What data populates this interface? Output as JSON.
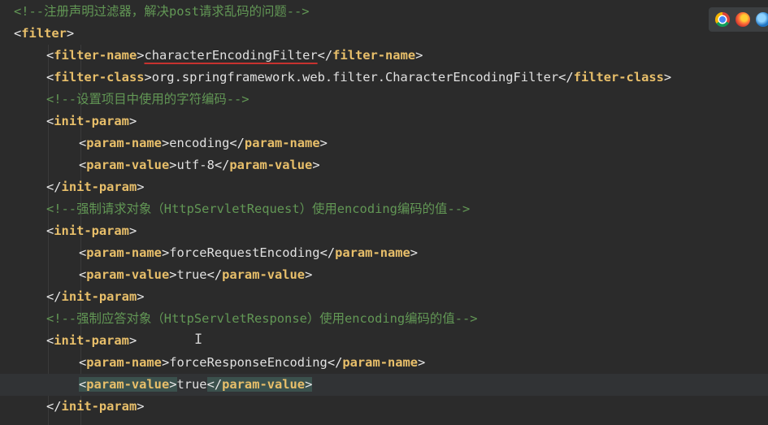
{
  "editor": {
    "lines": [
      {
        "indent": 0,
        "tokens": [
          {
            "t": "c",
            "v": "<!--注册声明过滤器，解决post请求乱码的问题-->"
          }
        ]
      },
      {
        "indent": 0,
        "tokens": [
          {
            "t": "b",
            "v": "<"
          },
          {
            "t": "g",
            "v": "filter"
          },
          {
            "t": "b",
            "v": ">"
          }
        ]
      },
      {
        "indent": 1,
        "tokens": [
          {
            "t": "b",
            "v": "<"
          },
          {
            "t": "g",
            "v": "filter-name"
          },
          {
            "t": "b",
            "v": ">"
          },
          {
            "t": "x",
            "v": "characterEncodingFilter",
            "squiggle": true
          },
          {
            "t": "b",
            "v": "</"
          },
          {
            "t": "g",
            "v": "filter-name"
          },
          {
            "t": "b",
            "v": ">"
          }
        ]
      },
      {
        "indent": 1,
        "tokens": [
          {
            "t": "b",
            "v": "<"
          },
          {
            "t": "g",
            "v": "filter-class"
          },
          {
            "t": "b",
            "v": ">"
          },
          {
            "t": "x",
            "v": "org.springframework.web.filter.CharacterEncodingFilter"
          },
          {
            "t": "b",
            "v": "</"
          },
          {
            "t": "g",
            "v": "filter-class"
          },
          {
            "t": "b",
            "v": ">"
          }
        ]
      },
      {
        "indent": 1,
        "tokens": [
          {
            "t": "c",
            "v": "<!--设置项目中使用的字符编码-->"
          }
        ]
      },
      {
        "indent": 1,
        "tokens": [
          {
            "t": "b",
            "v": "<"
          },
          {
            "t": "g",
            "v": "init-param"
          },
          {
            "t": "b",
            "v": ">"
          }
        ]
      },
      {
        "indent": 2,
        "tokens": [
          {
            "t": "b",
            "v": "<"
          },
          {
            "t": "g",
            "v": "param-name"
          },
          {
            "t": "b",
            "v": ">"
          },
          {
            "t": "x",
            "v": "encoding"
          },
          {
            "t": "b",
            "v": "</"
          },
          {
            "t": "g",
            "v": "param-name"
          },
          {
            "t": "b",
            "v": ">"
          }
        ]
      },
      {
        "indent": 2,
        "tokens": [
          {
            "t": "b",
            "v": "<"
          },
          {
            "t": "g",
            "v": "param-value"
          },
          {
            "t": "b",
            "v": ">"
          },
          {
            "t": "x",
            "v": "utf-8"
          },
          {
            "t": "b",
            "v": "</"
          },
          {
            "t": "g",
            "v": "param-value"
          },
          {
            "t": "b",
            "v": ">"
          }
        ]
      },
      {
        "indent": 1,
        "tokens": [
          {
            "t": "b",
            "v": "</"
          },
          {
            "t": "g",
            "v": "init-param"
          },
          {
            "t": "b",
            "v": ">"
          }
        ]
      },
      {
        "indent": 1,
        "tokens": [
          {
            "t": "c",
            "v": "<!--强制请求对象（HttpServletRequest）使用encoding编码的值-->"
          }
        ]
      },
      {
        "indent": 1,
        "tokens": [
          {
            "t": "b",
            "v": "<"
          },
          {
            "t": "g",
            "v": "init-param"
          },
          {
            "t": "b",
            "v": ">"
          }
        ]
      },
      {
        "indent": 2,
        "tokens": [
          {
            "t": "b",
            "v": "<"
          },
          {
            "t": "g",
            "v": "param-name"
          },
          {
            "t": "b",
            "v": ">"
          },
          {
            "t": "x",
            "v": "forceRequestEncoding"
          },
          {
            "t": "b",
            "v": "</"
          },
          {
            "t": "g",
            "v": "param-name"
          },
          {
            "t": "b",
            "v": ">"
          }
        ]
      },
      {
        "indent": 2,
        "tokens": [
          {
            "t": "b",
            "v": "<"
          },
          {
            "t": "g",
            "v": "param-value"
          },
          {
            "t": "b",
            "v": ">"
          },
          {
            "t": "x",
            "v": "true"
          },
          {
            "t": "b",
            "v": "</"
          },
          {
            "t": "g",
            "v": "param-value"
          },
          {
            "t": "b",
            "v": ">"
          }
        ]
      },
      {
        "indent": 1,
        "tokens": [
          {
            "t": "b",
            "v": "</"
          },
          {
            "t": "g",
            "v": "init-param"
          },
          {
            "t": "b",
            "v": ">"
          }
        ]
      },
      {
        "indent": 1,
        "tokens": [
          {
            "t": "c",
            "v": "<!--强制应答对象（HttpServletResponse）使用encoding编码的值-->"
          }
        ]
      },
      {
        "indent": 1,
        "tokens": [
          {
            "t": "b",
            "v": "<"
          },
          {
            "t": "g",
            "v": "init-param"
          },
          {
            "t": "b",
            "v": ">"
          }
        ]
      },
      {
        "indent": 2,
        "tokens": [
          {
            "t": "b",
            "v": "<"
          },
          {
            "t": "g",
            "v": "param-name"
          },
          {
            "t": "b",
            "v": ">"
          },
          {
            "t": "x",
            "v": "forceResponseEncoding"
          },
          {
            "t": "b",
            "v": "</"
          },
          {
            "t": "g",
            "v": "param-name"
          },
          {
            "t": "b",
            "v": ">"
          }
        ]
      },
      {
        "indent": 2,
        "current": true,
        "tokens": [
          {
            "t": "b",
            "v": "<",
            "match": true
          },
          {
            "t": "g",
            "v": "param-value",
            "match": true
          },
          {
            "t": "b",
            "v": ">",
            "match": true
          },
          {
            "t": "x",
            "v": "true"
          },
          {
            "t": "b",
            "v": "</",
            "match": true
          },
          {
            "t": "g",
            "v": "param-value",
            "match": true
          },
          {
            "t": "b",
            "v": ">",
            "match": true
          }
        ]
      },
      {
        "indent": 1,
        "tokens": [
          {
            "t": "b",
            "v": "</"
          },
          {
            "t": "g",
            "v": "init-param"
          },
          {
            "t": "b",
            "v": ">"
          }
        ]
      }
    ]
  },
  "colors": {
    "background": "#2b2b2b",
    "tag": "#e8bf6a",
    "comment": "#629755",
    "text": "#e0e0e0",
    "error_underline": "#c7322f",
    "tag_match_highlight": "#3b514d"
  },
  "browser_icons": [
    "chrome-icon",
    "firefox-icon",
    "edge-icon"
  ]
}
